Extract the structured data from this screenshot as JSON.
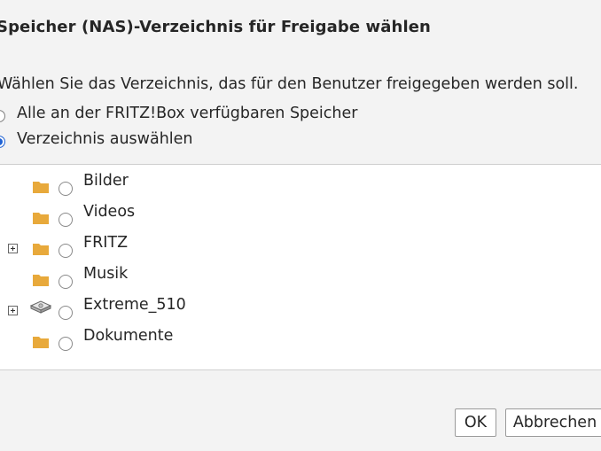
{
  "dialog": {
    "title": "Speicher (NAS)-Verzeichnis für Freigabe wählen",
    "instruction": "Wählen Sie das Verzeichnis, das für den Benutzer freigegeben werden soll.",
    "options": [
      {
        "label": "Alle an der FRITZ!Box verfügbaren Speicher",
        "selected": false
      },
      {
        "label": "Verzeichnis auswählen",
        "selected": true
      }
    ]
  },
  "tree": {
    "items": [
      {
        "label": "Bilder",
        "icon": "folder-icon",
        "expandable": false
      },
      {
        "label": "Videos",
        "icon": "folder-icon",
        "expandable": false
      },
      {
        "label": "FRITZ",
        "icon": "folder-icon",
        "expandable": true
      },
      {
        "label": "Musik",
        "icon": "folder-icon",
        "expandable": false
      },
      {
        "label": "Extreme_510",
        "icon": "drive-icon",
        "expandable": true
      },
      {
        "label": "Dokumente",
        "icon": "folder-icon",
        "expandable": false
      }
    ]
  },
  "buttons": {
    "ok": "OK",
    "cancel": "Abbrechen"
  },
  "colors": {
    "folder": "#e8a93b",
    "radio_selected": "#1f62d4",
    "background": "#f3f3f3"
  }
}
